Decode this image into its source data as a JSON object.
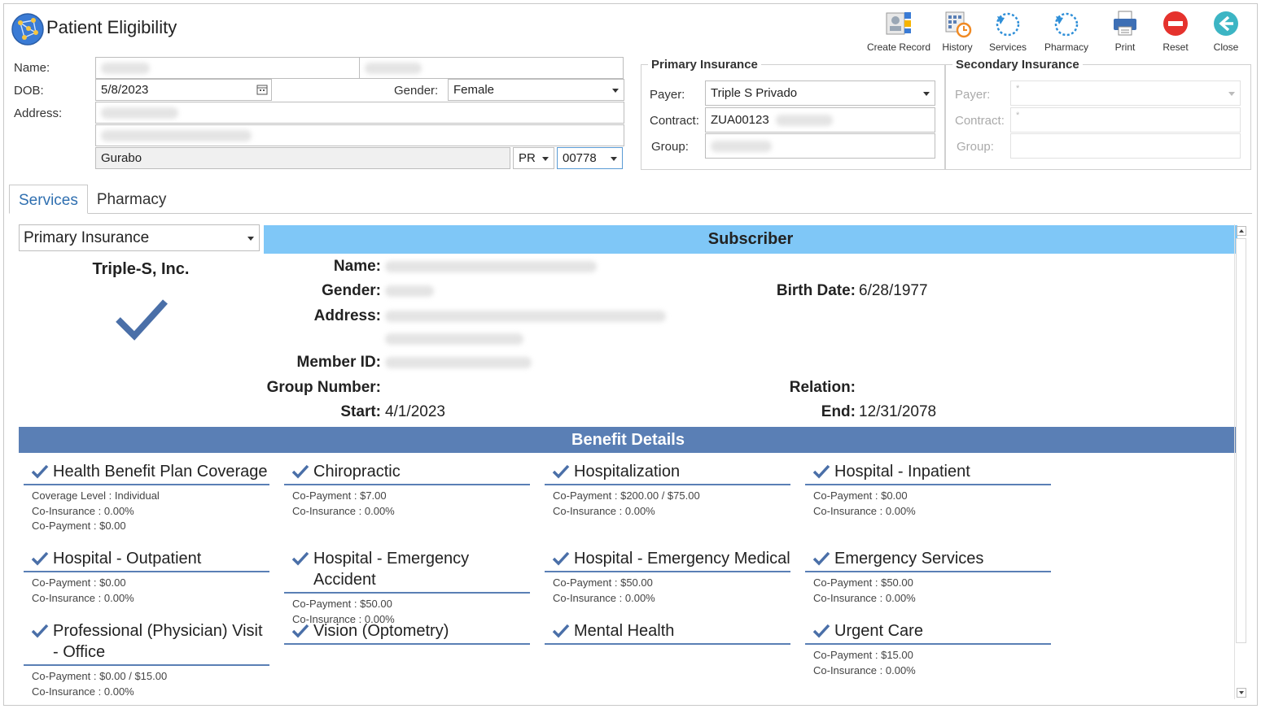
{
  "app": {
    "title": "Patient Eligibility"
  },
  "toolbar": {
    "create_record": "Create Record",
    "history": "History",
    "services": "Services",
    "pharmacy": "Pharmacy",
    "print": "Print",
    "reset": "Reset",
    "close": "Close"
  },
  "patient": {
    "name_label": "Name:",
    "dob_label": "DOB:",
    "dob": "5/8/2023",
    "gender_label": "Gender:",
    "gender": "Female",
    "address_label": "Address:",
    "city": "Gurabo",
    "state": "PR",
    "zip": "00778"
  },
  "primary_insurance": {
    "legend": "Primary Insurance",
    "payer_label": "Payer:",
    "payer": "Triple S Privado",
    "contract_label": "Contract:",
    "contract": "ZUA00123",
    "group_label": "Group:"
  },
  "secondary_insurance": {
    "legend": "Secondary Insurance",
    "payer_label": "Payer:",
    "payer": "*",
    "contract_label": "Contract:",
    "contract": "*",
    "group_label": "Group:"
  },
  "tabs": [
    {
      "label": "Services"
    },
    {
      "label": "Pharmacy"
    }
  ],
  "coverage_select": "Primary Insurance",
  "payer_name": "Triple-S, Inc.",
  "subscriber": {
    "header": "Subscriber",
    "name_label": "Name:",
    "gender_label": "Gender:",
    "address_label": "Address:",
    "member_id_label": "Member ID:",
    "group_number_label": "Group Number:",
    "start_label": "Start:",
    "start": "4/1/2023",
    "birth_date_label": "Birth Date:",
    "birth_date": "6/28/1977",
    "relation_label": "Relation:",
    "end_label": "End:",
    "end": "12/31/2078"
  },
  "benefits": {
    "header": "Benefit Details",
    "items": [
      {
        "title": "Health Benefit Plan Coverage",
        "lines": [
          "Coverage Level : Individual",
          "Co-Insurance : 0.00%",
          "Co-Payment : $0.00"
        ]
      },
      {
        "title": "Chiropractic",
        "lines": [
          "Co-Payment : $7.00",
          "Co-Insurance : 0.00%"
        ]
      },
      {
        "title": "Hospitalization",
        "lines": [
          "Co-Payment : $200.00 / $75.00",
          "Co-Insurance : 0.00%"
        ]
      },
      {
        "title": "Hospital - Inpatient",
        "lines": [
          "Co-Payment : $0.00",
          "Co-Insurance : 0.00%"
        ]
      },
      {
        "title": "Hospital - Outpatient",
        "lines": [
          "Co-Payment : $0.00",
          "Co-Insurance : 0.00%"
        ]
      },
      {
        "title": "Hospital - Emergency Accident",
        "lines": [
          "Co-Payment : $50.00",
          "Co-Insurance : 0.00%"
        ]
      },
      {
        "title": "Hospital - Emergency Medical",
        "lines": [
          "Co-Payment : $50.00",
          "Co-Insurance : 0.00%"
        ]
      },
      {
        "title": "Emergency Services",
        "lines": [
          "Co-Payment : $50.00",
          "Co-Insurance : 0.00%"
        ]
      },
      {
        "title": "Professional (Physician) Visit - Office",
        "lines": [
          "Co-Payment : $0.00 / $15.00",
          "Co-Insurance : 0.00%"
        ]
      },
      {
        "title": "Vision (Optometry)",
        "lines": []
      },
      {
        "title": "Mental Health",
        "lines": []
      },
      {
        "title": "Urgent Care",
        "lines": [
          "Co-Payment : $15.00",
          "Co-Insurance : 0.00%"
        ]
      }
    ]
  },
  "colors": {
    "accent": "#5a7fb5",
    "subscriber_header": "#7fc7f7",
    "tab_active": "#2f6fb0"
  }
}
